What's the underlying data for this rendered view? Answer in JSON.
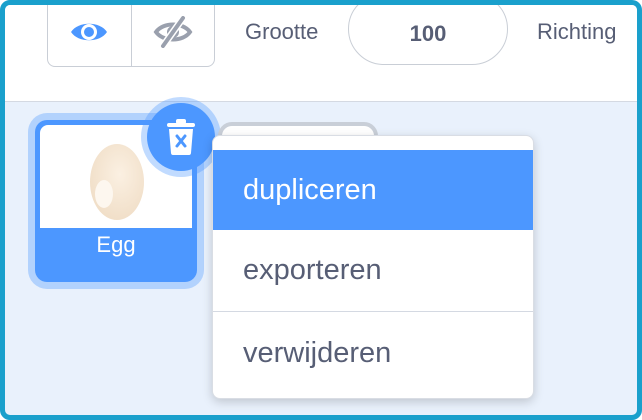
{
  "toolbar": {
    "show_icon": "eye-icon",
    "hide_icon": "eye-slash-icon",
    "size_label": "Grootte",
    "size_value": "100",
    "direction_label": "Richting"
  },
  "sprites": [
    {
      "name": "Egg",
      "selected": true,
      "thumbnail": "egg"
    }
  ],
  "delete_button": {
    "icon": "trash-icon"
  },
  "context_menu": {
    "items": [
      {
        "label": "dupliceren",
        "active": true
      },
      {
        "label": "exporteren",
        "active": false
      },
      {
        "label": "verwijderen",
        "active": false
      }
    ]
  },
  "colors": {
    "accent": "#4c97ff",
    "frame": "#1aa0cc",
    "text": "#575e75",
    "pane_bg": "#e9f1fc"
  }
}
